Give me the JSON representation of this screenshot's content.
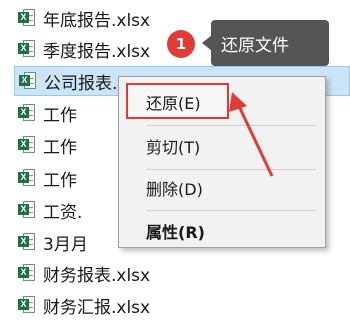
{
  "files": [
    {
      "name": "年底报告.xlsx",
      "icon": "excel-file-icon",
      "selected": false
    },
    {
      "name": "季度报告.xlsx",
      "icon": "excel-file-icon",
      "selected": false
    },
    {
      "name": "公司报表.xl",
      "icon": "excel-file-icon",
      "selected": true
    },
    {
      "name": "工作",
      "icon": "excel-file-icon",
      "selected": false
    },
    {
      "name": "工作",
      "icon": "excel-file-icon",
      "selected": false
    },
    {
      "name": "工作",
      "icon": "excel-file-icon",
      "selected": false
    },
    {
      "name": "工资.",
      "icon": "excel-file-icon",
      "selected": false
    },
    {
      "name": "3月月",
      "icon": "excel-file-icon",
      "selected": false
    },
    {
      "name": "财务报表.xlsx",
      "icon": "excel-file-icon",
      "selected": false
    },
    {
      "name": "财务汇报.xlsx",
      "icon": "excel-file-icon",
      "selected": false
    }
  ],
  "excel_badge_letter": "X",
  "context_menu": {
    "restore": "还原(E)",
    "cut": "剪切(T)",
    "delete": "删除(D)",
    "properties": "属性(R)"
  },
  "annotation": {
    "step_number": "1",
    "tooltip_text": "还原文件",
    "highlight_color": "#e03c35"
  },
  "colors": {
    "selection_bg": "#cce4f7",
    "menu_bg": "#f2f2f2",
    "tooltip_bg": "#555555",
    "excel_green": "#1e7145"
  }
}
